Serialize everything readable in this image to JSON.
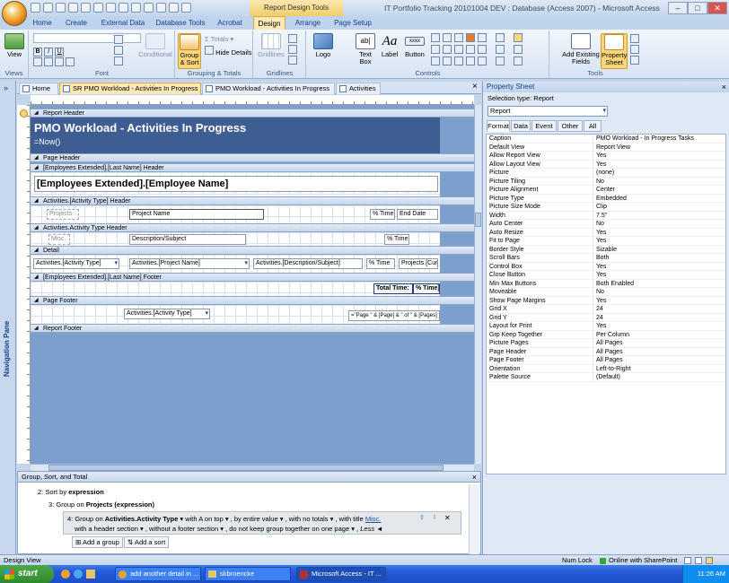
{
  "window": {
    "context_tab": "Report Design Tools",
    "title": "IT Portfolio Tracking 20101004 DEV : Database (Access 2007) - Microsoft Access",
    "min": "–",
    "max": "□",
    "close": "✕"
  },
  "ribbon": {
    "tabs": [
      "Home",
      "Create",
      "External Data",
      "Database Tools",
      "Acrobat",
      "Design",
      "Arrange",
      "Page Setup"
    ],
    "groups": {
      "views": "Views",
      "font": "Font",
      "grouping": "Grouping & Totals",
      "gridlines": "Gridlines",
      "controls": "Controls",
      "tools": "Tools"
    },
    "buttons": {
      "view": "View",
      "conditional": "Conditional",
      "group_sort": "Group & Sort",
      "totals": "Totals",
      "hide_details": "Hide Details",
      "gridlines": "Gridlines",
      "logo": "Logo",
      "text_box": "Text Box",
      "label": "Label",
      "button": "Button",
      "add_existing": "Add Existing Fields",
      "property_sheet": "Property Sheet"
    },
    "label_glyph": "Aa",
    "button_glyph": "xxxx",
    "text_glyph": "ab|"
  },
  "nav_pane": {
    "label": "Navigation Pane",
    "toggle": "»"
  },
  "doc_tabs": [
    "Home",
    "SR PMO Workload - Activities In Progress",
    "PMO Workload - Activities In Progress",
    "Activities"
  ],
  "doc_close": "×",
  "report": {
    "bands": {
      "report_header": "Report Header",
      "page_header": "Page Header",
      "emp_header": "[Employees Extended].[Last Name] Header",
      "type_header1": "Activities.[Activity Type] Header",
      "type_header2": "Activities.Activity Type Header",
      "detail": "Detail",
      "emp_footer": "[Employees Extended].[Last Name] Footer",
      "page_footer": "Page Footer",
      "report_footer": "Report Footer"
    },
    "title": "PMO Workload - Activities In Progress",
    "now": "=Now()",
    "employee_name": "[Employees Extended].[Employee Name]",
    "projects_lbl": "Projects",
    "project_name": "Project Name",
    "pct_time": "% Time",
    "end_date": "End Date",
    "misc_lbl": "Misc.",
    "desc_subject": "Description/Subject",
    "pct_time2": "% Time",
    "detail_type": "Activities.[Activity Type]",
    "detail_project": "Activities.[Project Name]",
    "detail_desc": "Activities.[Description/Subject]",
    "detail_pct": "% Time",
    "detail_projcur": "Projects.[Cur",
    "total_time": "Total Time:",
    "total_expr": "% Time])",
    "footer_type": "Activities.[Activity Type]",
    "footer_pages": "=\"Page \" & [Page] & \" of \" & [Pages]"
  },
  "group_sort": {
    "title": "Group, Sort, and Total",
    "close": "×",
    "sort1_prefix": "Sort by",
    "sort1_field": "expression",
    "group2_prefix": "Group on",
    "group2_field": "Projects (expression)",
    "group3_prefix": "Group on",
    "group3_field": "Activities.Activity Type",
    "opt_a_on_top": "with A on top",
    "opt_entire": "by entire value",
    "opt_no_totals": "with no totals",
    "opt_title": "with title",
    "opt_title_val": "Misc.",
    "opt_header": "with a header section",
    "opt_no_footer": "without a footer section",
    "opt_keep": "do not keep group together on one page",
    "opt_less": "Less ◄",
    "add_group": "Add a group",
    "add_sort": "Add a sort"
  },
  "property_sheet": {
    "title": "Property Sheet",
    "close": "×",
    "selection_type_label": "Selection type:",
    "selection_type": "Report",
    "selector_value": "Report",
    "tabs": [
      "Format",
      "Data",
      "Event",
      "Other",
      "All"
    ],
    "rows": [
      [
        "Caption",
        "PMO Workload - In Progress Tasks"
      ],
      [
        "Default View",
        "Report View"
      ],
      [
        "Allow Report View",
        "Yes"
      ],
      [
        "Allow Layout View",
        "Yes"
      ],
      [
        "Picture",
        "(none)"
      ],
      [
        "Picture Tiling",
        "No"
      ],
      [
        "Picture Alignment",
        "Center"
      ],
      [
        "Picture Type",
        "Embedded"
      ],
      [
        "Picture Size Mode",
        "Clip"
      ],
      [
        "Width",
        "7.5\""
      ],
      [
        "Auto Center",
        "No"
      ],
      [
        "Auto Resize",
        "Yes"
      ],
      [
        "Fit to Page",
        "Yes"
      ],
      [
        "Border Style",
        "Sizable"
      ],
      [
        "Scroll Bars",
        "Both"
      ],
      [
        "Control Box",
        "Yes"
      ],
      [
        "Close Button",
        "Yes"
      ],
      [
        "Min Max Buttons",
        "Both Enabled"
      ],
      [
        "Moveable",
        "No"
      ],
      [
        "Show Page Margins",
        "Yes"
      ],
      [
        "Grid X",
        "24"
      ],
      [
        "Grid Y",
        "24"
      ],
      [
        "Layout for Print",
        "Yes"
      ],
      [
        "Grp Keep Together",
        "Per Column"
      ],
      [
        "Picture Pages",
        "All Pages"
      ],
      [
        "Page Header",
        "All Pages"
      ],
      [
        "Page Footer",
        "All Pages"
      ],
      [
        "Orientation",
        "Left-to-Right"
      ],
      [
        "Palette Source",
        "(Default)"
      ]
    ]
  },
  "status": {
    "left": "Design View",
    "num_lock": "Num Lock",
    "sharepoint": "Online with SharePoint"
  },
  "taskbar": {
    "start": "start",
    "tasks": [
      "add another detail in ...",
      "skbroencke",
      "Microsoft Access - IT ..."
    ],
    "clock": "11:26 AM"
  }
}
